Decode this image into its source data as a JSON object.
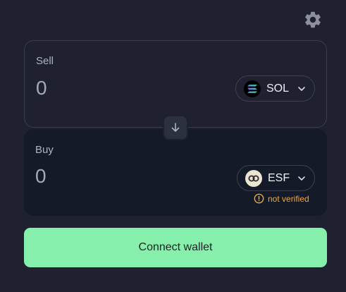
{
  "settings": {
    "icon": "gear-icon"
  },
  "sell": {
    "label": "Sell",
    "amount": "0",
    "token": {
      "symbol": "SOL",
      "icon": "sol-logo"
    }
  },
  "swap": {
    "icon": "arrow-down-icon"
  },
  "buy": {
    "label": "Buy",
    "amount": "0",
    "token": {
      "symbol": "ESF",
      "icon": "esf-logo"
    },
    "warning": "not verified"
  },
  "connect_label": "Connect wallet",
  "colors": {
    "background": "#1f2030",
    "buy_panel": "#141a28",
    "accent_green": "#86efac",
    "warning": "#f0a83a"
  }
}
